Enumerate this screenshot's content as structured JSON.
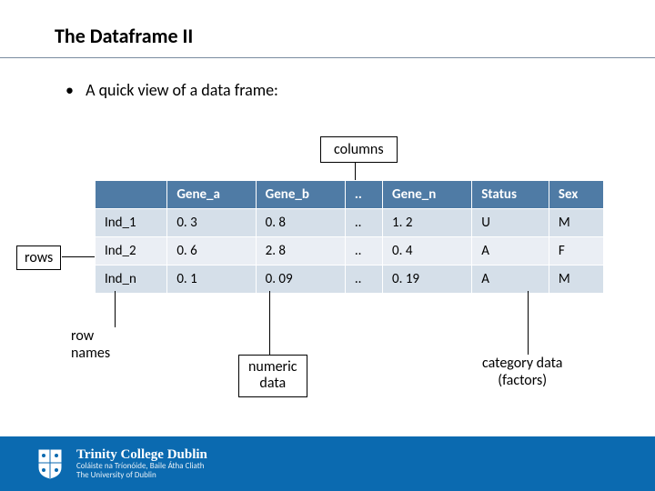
{
  "title": "The Dataframe II",
  "bullet": "A quick view of a data frame:",
  "labels": {
    "columns": "columns",
    "rows": "rows",
    "row_names_l1": "row",
    "row_names_l2": "names",
    "numeric_l1": "numeric",
    "numeric_l2": "data",
    "category_l1": "category data",
    "category_l2": "(factors)"
  },
  "table": {
    "headers": [
      "",
      "Gene_a",
      "Gene_b",
      "..",
      "Gene_n",
      "Status",
      "Sex"
    ],
    "rows": [
      {
        "name": "Ind_1",
        "cells": [
          "0. 3",
          "0. 8",
          "..",
          "1. 2",
          "U",
          "M"
        ]
      },
      {
        "name": "Ind_2",
        "cells": [
          "0. 6",
          "2. 8",
          "..",
          "0. 4",
          "A",
          "F"
        ]
      },
      {
        "name": "Ind_n",
        "cells": [
          "0. 1",
          "0. 09",
          "..",
          "0. 19",
          "A",
          "M"
        ]
      }
    ]
  },
  "footer": {
    "university": "Trinity College Dublin",
    "subtitle1": "Coláiste na Tríonóide, Baile Átha Cliath",
    "subtitle2": "The University of Dublin"
  }
}
